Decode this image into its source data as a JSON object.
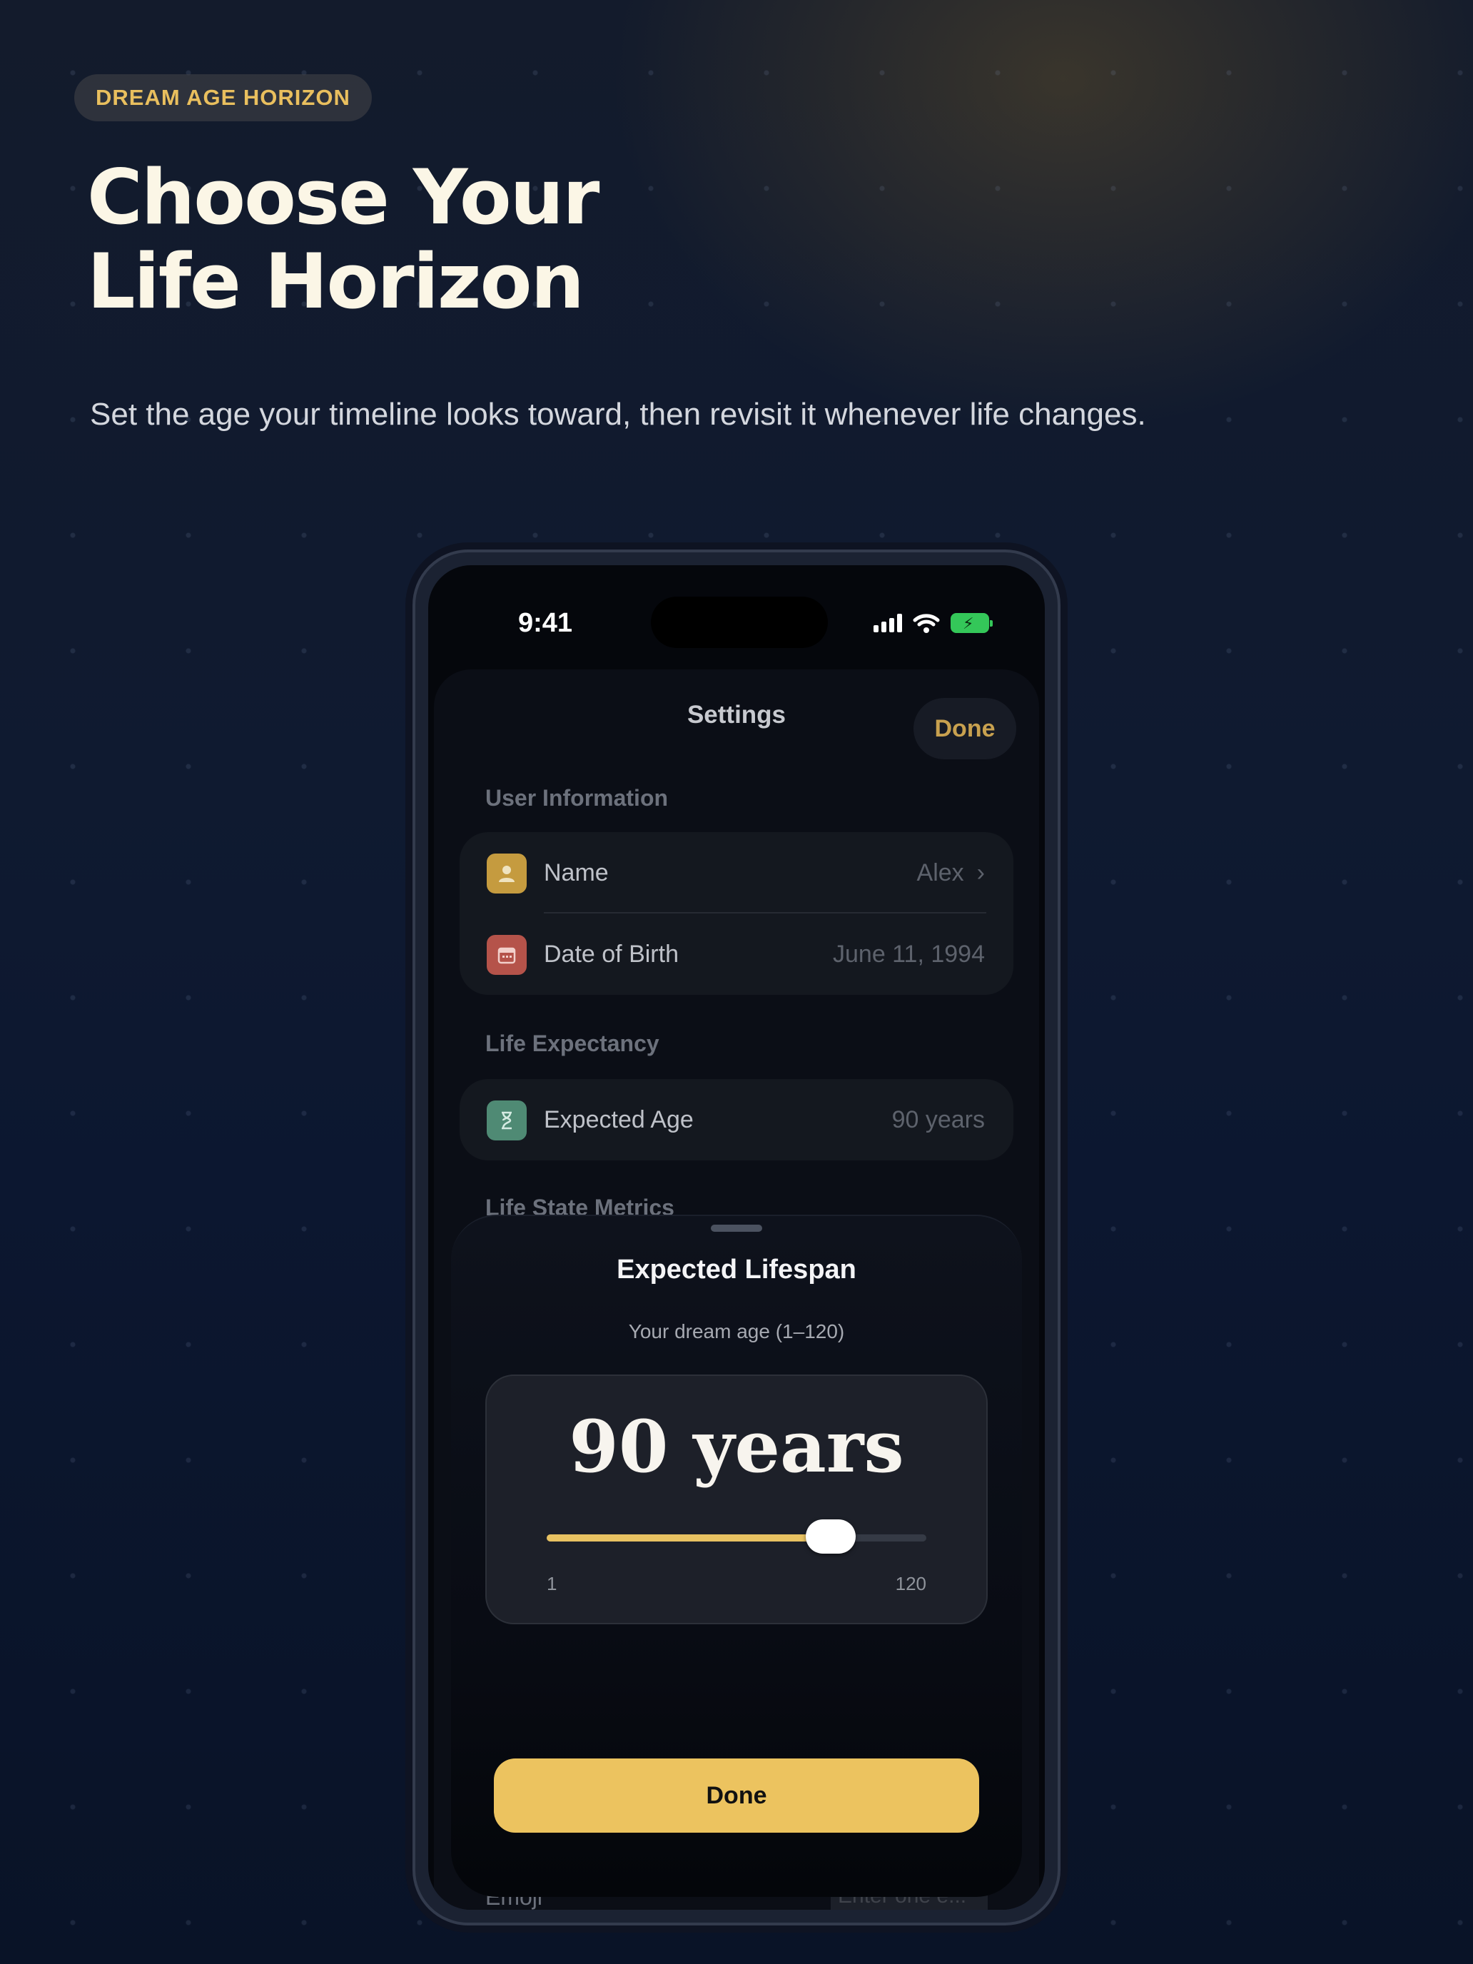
{
  "badge": "DREAM AGE HORIZON",
  "hero": {
    "title": "Choose Your\nLife Horizon",
    "subtitle": "Set the age your timeline looks toward, then revisit it whenever life changes."
  },
  "status_bar": {
    "time": "9:41"
  },
  "settings": {
    "title": "Settings",
    "done_label": "Done",
    "sections": [
      {
        "label": "User Information",
        "rows": [
          {
            "label": "Name",
            "value": "Alex",
            "icon": "person-icon",
            "icon_color": "#c59b3f"
          },
          {
            "label": "Date of Birth",
            "value": "June 11, 1994",
            "icon": "calendar-icon",
            "icon_color": "#b5534a"
          }
        ]
      },
      {
        "label": "Life Expectancy",
        "rows": [
          {
            "label": "Expected Age",
            "value": "90 years",
            "icon": "hourglass-icon",
            "icon_color": "#4f8a74"
          }
        ]
      },
      {
        "label": "Life State Metrics",
        "rows": []
      }
    ],
    "peek_row": {
      "label": "Emoji",
      "placeholder": "Enter one e..."
    }
  },
  "sheet": {
    "title": "Expected Lifespan",
    "subtitle": "Your dream age (1–120)",
    "value_display": "90 years",
    "slider": {
      "min": 1,
      "max": 120,
      "value": 90,
      "min_label": "1",
      "max_label": "120"
    },
    "done_label": "Done"
  },
  "colors": {
    "accent": "#ecc35f",
    "background": "#0f1a30"
  }
}
